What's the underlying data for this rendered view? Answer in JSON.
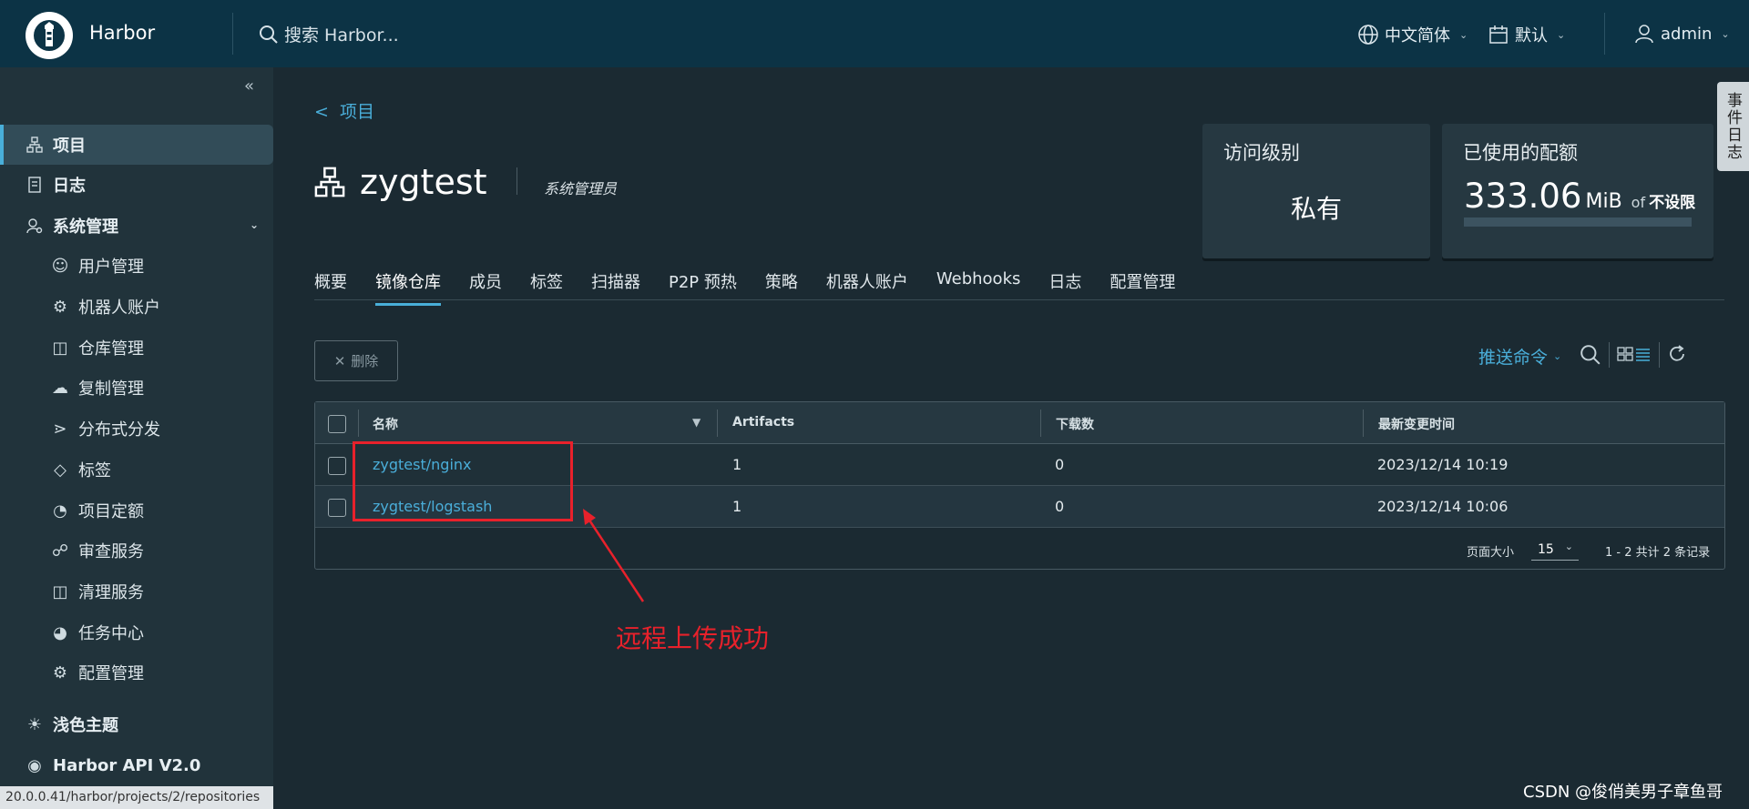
{
  "header": {
    "app_name": "Harbor",
    "search_placeholder": "搜索 Harbor...",
    "language": "中文简体",
    "datetime_format": "默认",
    "user": "admin"
  },
  "sidebar": {
    "items": [
      {
        "label": "项目",
        "icon": "projects-icon"
      },
      {
        "label": "日志",
        "icon": "logs-icon"
      },
      {
        "label": "系统管理",
        "icon": "admin-icon"
      },
      {
        "label": "用户管理",
        "icon": "users-icon"
      },
      {
        "label": "机器人账户",
        "icon": "robot-icon"
      },
      {
        "label": "仓库管理",
        "icon": "registry-icon"
      },
      {
        "label": "复制管理",
        "icon": "replication-icon"
      },
      {
        "label": "分布式分发",
        "icon": "distribution-icon"
      },
      {
        "label": "标签",
        "icon": "tag-icon"
      },
      {
        "label": "项目定额",
        "icon": "quota-icon"
      },
      {
        "label": "审查服务",
        "icon": "interrogation-icon"
      },
      {
        "label": "清理服务",
        "icon": "cleanup-icon"
      },
      {
        "label": "任务中心",
        "icon": "jobs-icon"
      },
      {
        "label": "配置管理",
        "icon": "config-icon"
      }
    ],
    "theme_toggle": "浅色主题",
    "api_link": "Harbor API V2.0",
    "status_url": "20.0.0.41/harbor/projects/2/repositories"
  },
  "project": {
    "back_label": "项目",
    "name": "zygtest",
    "role": "系统管理员",
    "access_card_title": "访问级别",
    "access_level": "私有",
    "quota_card_title": "已使用的配额",
    "quota_used": "333.06",
    "quota_unit": "MiB",
    "quota_of": "of",
    "quota_limit": "不设限",
    "quota_fraction": 0
  },
  "tabs": [
    "概要",
    "镜像仓库",
    "成员",
    "标签",
    "扫描器",
    "P2P 预热",
    "策略",
    "机器人账户",
    "Webhooks",
    "日志",
    "配置管理"
  ],
  "active_tab": "镜像仓库",
  "toolbar": {
    "delete_label": "删除",
    "push_command_label": "推送命令"
  },
  "table": {
    "columns": [
      "名称",
      "Artifacts",
      "下载数",
      "最新变更时间"
    ],
    "rows": [
      {
        "name": "zygtest/nginx",
        "artifacts": "1",
        "pulls": "0",
        "updated": "2023/12/14 10:19"
      },
      {
        "name": "zygtest/logstash",
        "artifacts": "1",
        "pulls": "0",
        "updated": "2023/12/14 10:06"
      }
    ],
    "page_size_label": "页面大小",
    "page_size": "15",
    "record_count": "1 - 2 共计 2 条记录"
  },
  "annotation": {
    "text": "远程上传成功",
    "color": "#e8212b"
  },
  "side_tab": "事件日志",
  "watermark": "CSDN @俊俏美男子章鱼哥",
  "colors": {
    "accent": "#49afd9",
    "header_bg": "#0c3345",
    "sidebar_bg": "#21333b",
    "main_bg": "#1b2a32"
  }
}
